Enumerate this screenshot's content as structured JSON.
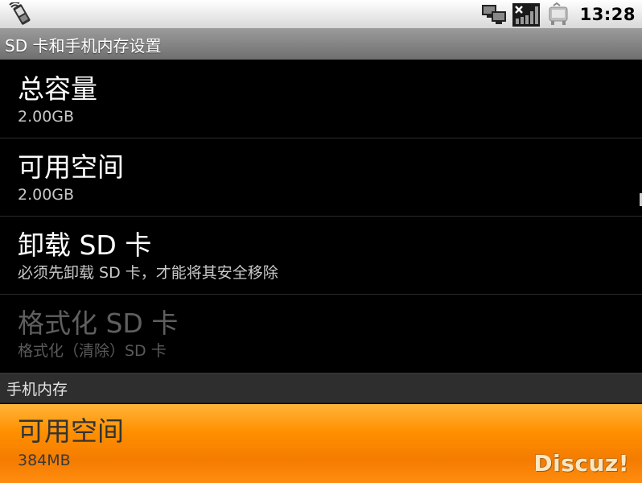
{
  "status_bar": {
    "time": "13:28",
    "icons": [
      "phone-signal-icon",
      "network-computer-icon",
      "signal-bars-no-service-icon",
      "sync-icon"
    ]
  },
  "title_bar": {
    "title": "SD 卡和手机内存设置"
  },
  "sd_section": {
    "items": [
      {
        "title": "总容量",
        "summary": "2.00GB",
        "enabled": true
      },
      {
        "title": "可用空间",
        "summary": "2.00GB",
        "enabled": true
      },
      {
        "title": "卸载 SD 卡",
        "summary": "必须先卸载 SD 卡，才能将其安全移除",
        "enabled": true
      },
      {
        "title": "格式化 SD 卡",
        "summary": "格式化（清除）SD 卡",
        "enabled": false
      }
    ]
  },
  "phone_section": {
    "header": "手机内存",
    "items": [
      {
        "title": "可用空间",
        "summary": "384MB",
        "selected": true
      }
    ]
  },
  "watermark": "Discuz!",
  "colors": {
    "highlight": "#ff9000",
    "status_bar": "#e8e8e8",
    "title_bar": "#858585",
    "category_header": "#2e2e2e"
  }
}
